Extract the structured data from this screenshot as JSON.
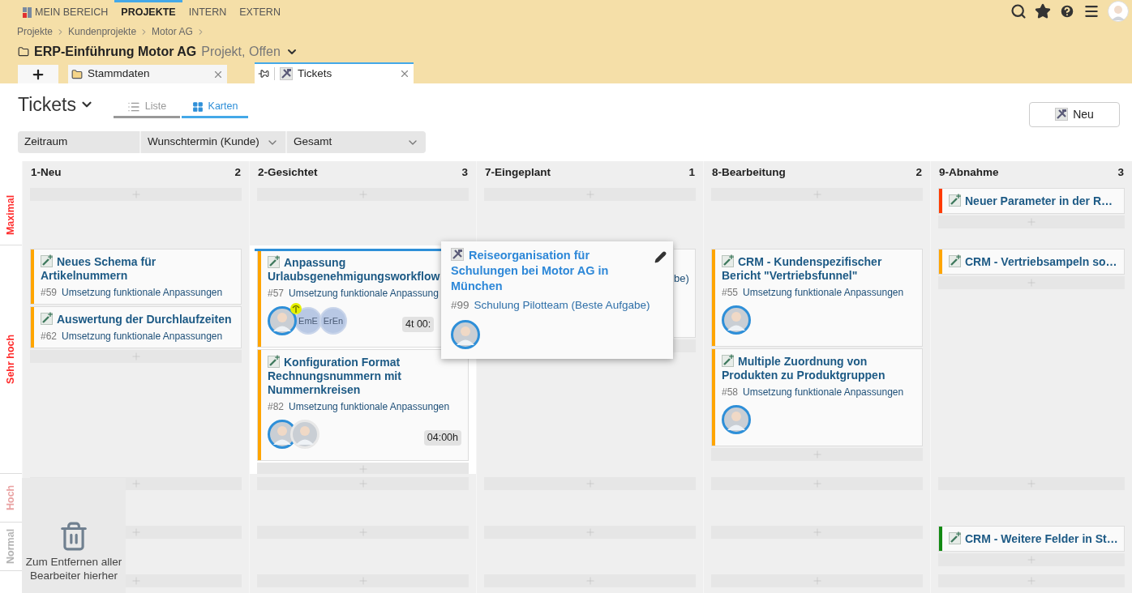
{
  "nav": {
    "items": [
      {
        "label": "MEIN BEREICH",
        "selected": false,
        "kind": "home"
      },
      {
        "label": "PROJEKTE",
        "selected": true
      },
      {
        "label": "INTERN",
        "selected": false
      },
      {
        "label": "EXTERN",
        "selected": false
      }
    ]
  },
  "breadcrumb": [
    "Projekte",
    "Kundenprojekte",
    "Motor AG"
  ],
  "project": {
    "name": "ERP-Einführung Motor AG",
    "status": "Projekt, Offen"
  },
  "tabs": [
    {
      "label": "Stammdaten",
      "selected": false,
      "kind": "folder"
    },
    {
      "label": "Tickets",
      "selected": true,
      "kind": "tickets"
    }
  ],
  "page_title": "Tickets",
  "views": [
    {
      "label": "Liste",
      "selected": false,
      "kind": "list"
    },
    {
      "label": "Karten",
      "selected": true,
      "kind": "cards"
    }
  ],
  "new_button": "Neu",
  "filters": [
    {
      "label": "Zeitraum",
      "dropdown": false
    },
    {
      "label": "Wunschtermin (Kunde)",
      "dropdown": true
    },
    {
      "label": "Gesamt",
      "dropdown": true
    }
  ],
  "columns": [
    {
      "name": "1-Neu",
      "count": "2"
    },
    {
      "name": "2-Gesichtet",
      "count": "3"
    },
    {
      "name": "7-Eingeplant",
      "count": "1"
    },
    {
      "name": "8-Bearbeitung",
      "count": "2"
    },
    {
      "name": "9-Abnahme",
      "count": "3"
    }
  ],
  "lanes": [
    {
      "label": "Maximal",
      "color": "#ff2d2d",
      "cells": [
        {},
        {},
        {},
        {},
        {
          "cards": [
            {
              "title": "Neuer Parameter in der R…",
              "color": "#ff3b00"
            }
          ]
        }
      ]
    },
    {
      "label": "Sehr hoch",
      "color": "#ff2d2d",
      "cells": [
        {
          "cards": [
            {
              "title": "Neues Schema für Artikelnummern",
              "number": "#59",
              "project": "Umsetzung funktionale Anpassungen",
              "color": "#ffa500"
            },
            {
              "title": "Auswertung der Durchlaufzeiten",
              "number": "#62",
              "project": "Umsetzung funktionale Anpassungen",
              "color": "#ffa500"
            }
          ]
        },
        {
          "highlighted": true,
          "cards": [
            {
              "title": "Anpassung Urlaubsgenehmigungsworkflow",
              "number": "#57",
              "project": "Umsetzung funktionale Anpassung",
              "color": "#ffa500",
              "time": "4t 00:",
              "avatars": [
                {
                  "kind": "photo",
                  "vacation": true
                },
                {
                  "kind": "initials",
                  "text": "EmE"
                },
                {
                  "kind": "initials",
                  "text": "ErEn"
                }
              ]
            },
            {
              "title": "Konfiguration Format Rechnungsnummern mit Nummernkreisen",
              "number": "#82",
              "project": "Umsetzung funktionale Anpassungen",
              "color": "#ffa500",
              "time": "04:00h",
              "avatars": [
                {
                  "kind": "photo"
                },
                {
                  "kind": "photo"
                }
              ]
            }
          ]
        },
        {
          "cards": [
            {
              "kind": "covered",
              "text": "be)"
            }
          ]
        },
        {
          "cards": [
            {
              "title": "CRM - Kundenspezifischer Bericht \"Vertriebsfunnel\"",
              "number": "#55",
              "project": "Umsetzung funktionale Anpassungen",
              "color": "#ffa500",
              "avatars": [
                {
                  "kind": "photo"
                }
              ]
            },
            {
              "title": "Multiple Zuordnung von Produkten zu Produktgruppen",
              "number": "#58",
              "project": "Umsetzung funktionale Anpassungen",
              "color": "#ffa500",
              "avatars": [
                {
                  "kind": "photo"
                }
              ]
            }
          ]
        },
        {
          "cards": [
            {
              "title": "CRM - Vertriebsampeln so…",
              "color": "#ffa500"
            }
          ]
        }
      ]
    },
    {
      "label": "Hoch",
      "color": "#e9a3a3",
      "cells": [
        {},
        {},
        {},
        {},
        {}
      ]
    },
    {
      "label": "Normal",
      "color": "#b4b4b4",
      "cells": [
        {},
        {},
        {},
        {},
        {
          "cards": [
            {
              "title": "CRM - Weitere Felder in St…",
              "color": "#138a13"
            }
          ]
        }
      ]
    },
    {
      "cells": [
        {},
        {},
        {},
        {},
        {}
      ]
    }
  ],
  "popup": {
    "title": "Reiseorganisation für Schulungen bei Motor AG in München",
    "number": "#99",
    "project": "Schulung Pilotteam (Beste Aufgabe)",
    "avatars": [
      {
        "kind": "photo"
      }
    ]
  },
  "trash": {
    "text": "Zum Entfernen aller Bearbeiter hierher"
  }
}
